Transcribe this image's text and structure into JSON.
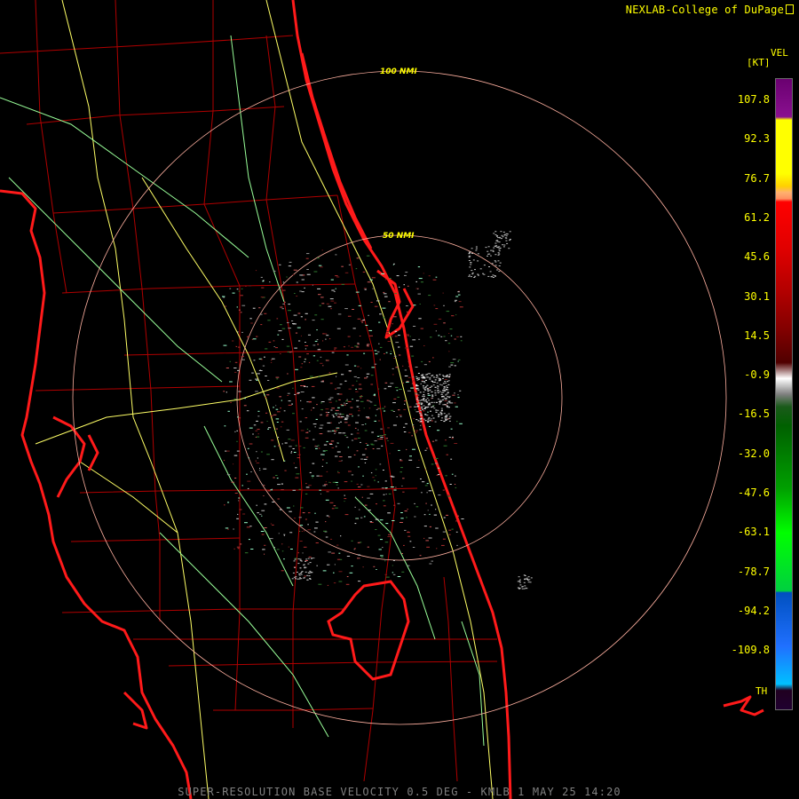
{
  "header": {
    "credit": "NEXLAB-College of DuPage"
  },
  "legend": {
    "product": "VEL",
    "units": "[KT]",
    "ticks": [
      "107.8",
      "92.3",
      "76.7",
      "61.2",
      "45.6",
      "30.1",
      "14.5",
      "-0.9",
      "-16.5",
      "-32.0",
      "-47.6",
      "-63.1",
      "-78.7",
      "-94.2",
      "-109.8"
    ],
    "threshold_label": "TH"
  },
  "range_rings": {
    "inner_label": "50 NMI",
    "outer_label": "100 NMI"
  },
  "footer": {
    "caption": "SUPER-RESOLUTION BASE VELOCITY 0.5 DEG - KMLB 1 MAY 25 14:20"
  },
  "colors": {
    "coastline": "#ff1a1a",
    "county_border": "#b00000",
    "highway": "#ffff66",
    "road": "#99ff99",
    "ring": "#ffb0a0",
    "label": "#ffff00"
  }
}
